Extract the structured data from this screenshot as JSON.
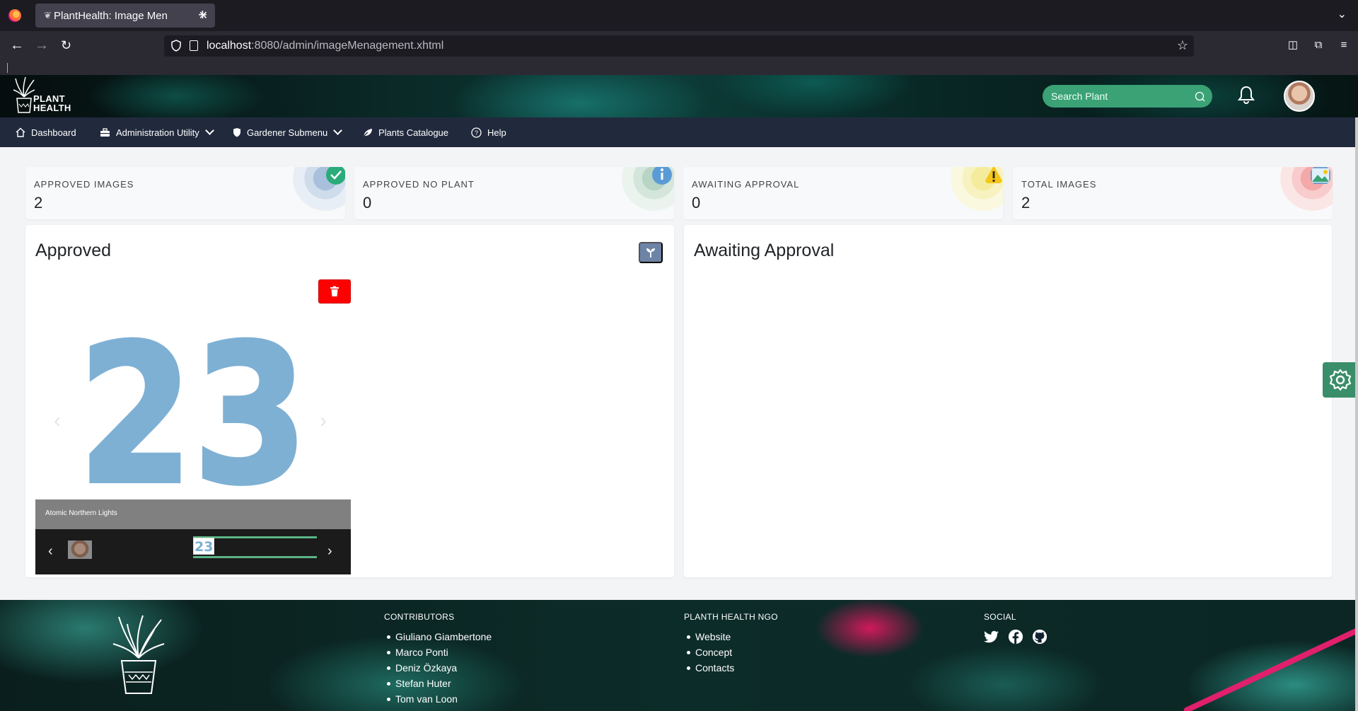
{
  "browser": {
    "tab_title": "PlantHealth: Image Men",
    "url_host": "localhost",
    "url_path": ":8080/admin/imageMenagement.xhtml"
  },
  "header": {
    "logo_line1": "PLANT",
    "logo_line2": "HEALTH",
    "search_placeholder": "Search Plant"
  },
  "menu": {
    "items": [
      {
        "label": "Dashboard",
        "icon": "home-icon"
      },
      {
        "label": "Administration Utility",
        "icon": "toolbox-icon"
      },
      {
        "label": "Gardener Submenu",
        "icon": "shield-icon"
      },
      {
        "label": "Plants Catalogue",
        "icon": "leaf-icon"
      },
      {
        "label": "Help",
        "icon": "question-icon"
      }
    ]
  },
  "stats": [
    {
      "label": "APPROVED IMAGES",
      "value": "2",
      "icon": "check-circle-icon",
      "color": "#2bab7a"
    },
    {
      "label": "APPROVED NO PLANT",
      "value": "0",
      "icon": "info-circle-icon",
      "color": "#5b9bd5"
    },
    {
      "label": "AWAITING APPROVAL",
      "value": "0",
      "icon": "warning-icon",
      "color": "#f5c518"
    },
    {
      "label": "TOTAL IMAGES",
      "value": "2",
      "icon": "image-icon",
      "color": "#f28b8b"
    }
  ],
  "approved": {
    "title": "Approved",
    "image_text": "23",
    "caption": "Atomic Northern Lights",
    "thumb_text": "23"
  },
  "awaiting": {
    "title": "Awaiting Approval"
  },
  "footer": {
    "contributors_heading": "CONTRIBUTORS",
    "contributors": [
      "Giuliano Giambertone",
      "Marco Ponti",
      "Deniz Özkaya",
      "Stefan Huter",
      "Tom van Loon"
    ],
    "ngo_heading": "PLANTH HEALTH NGO",
    "ngo_links": [
      "Website",
      "Concept",
      "Contacts"
    ],
    "social_heading": "SOCIAL",
    "social_icons": [
      "twitter-icon",
      "facebook-icon",
      "github-icon"
    ]
  },
  "colors": {
    "menu_bg": "#212a3d",
    "search_bg": "#3aa275",
    "delete": "#ff0000",
    "plant_button": "#6d84a6",
    "settings_tab": "#3a8e6a"
  }
}
